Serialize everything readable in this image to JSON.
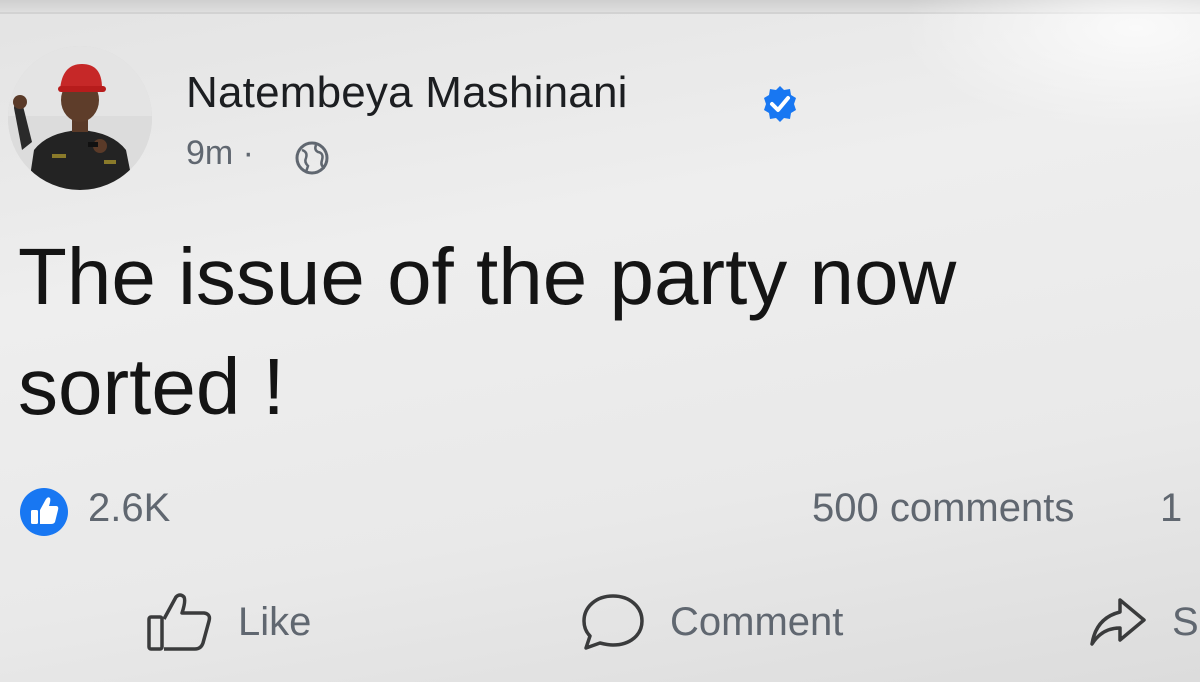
{
  "post": {
    "author": "Natembeya Mashinani",
    "time": "9m ·",
    "text": "The issue of the party now sorted !",
    "reactions_count": "2.6K",
    "comments_count": "500 comments",
    "shares_count_partial": "1"
  },
  "actions": {
    "like_label": "Like",
    "comment_label": "Comment",
    "share_label_partial": "S"
  },
  "icons": {
    "verified": "verified-badge-icon",
    "audience": "globe-icon",
    "reaction": "like-reaction-icon",
    "like": "thumbs-up-icon",
    "comment": "comment-bubble-icon",
    "share": "share-arrow-icon"
  },
  "colors": {
    "accent": "#1877f2",
    "text": "#1c1e21",
    "secondary_text": "#606770"
  }
}
